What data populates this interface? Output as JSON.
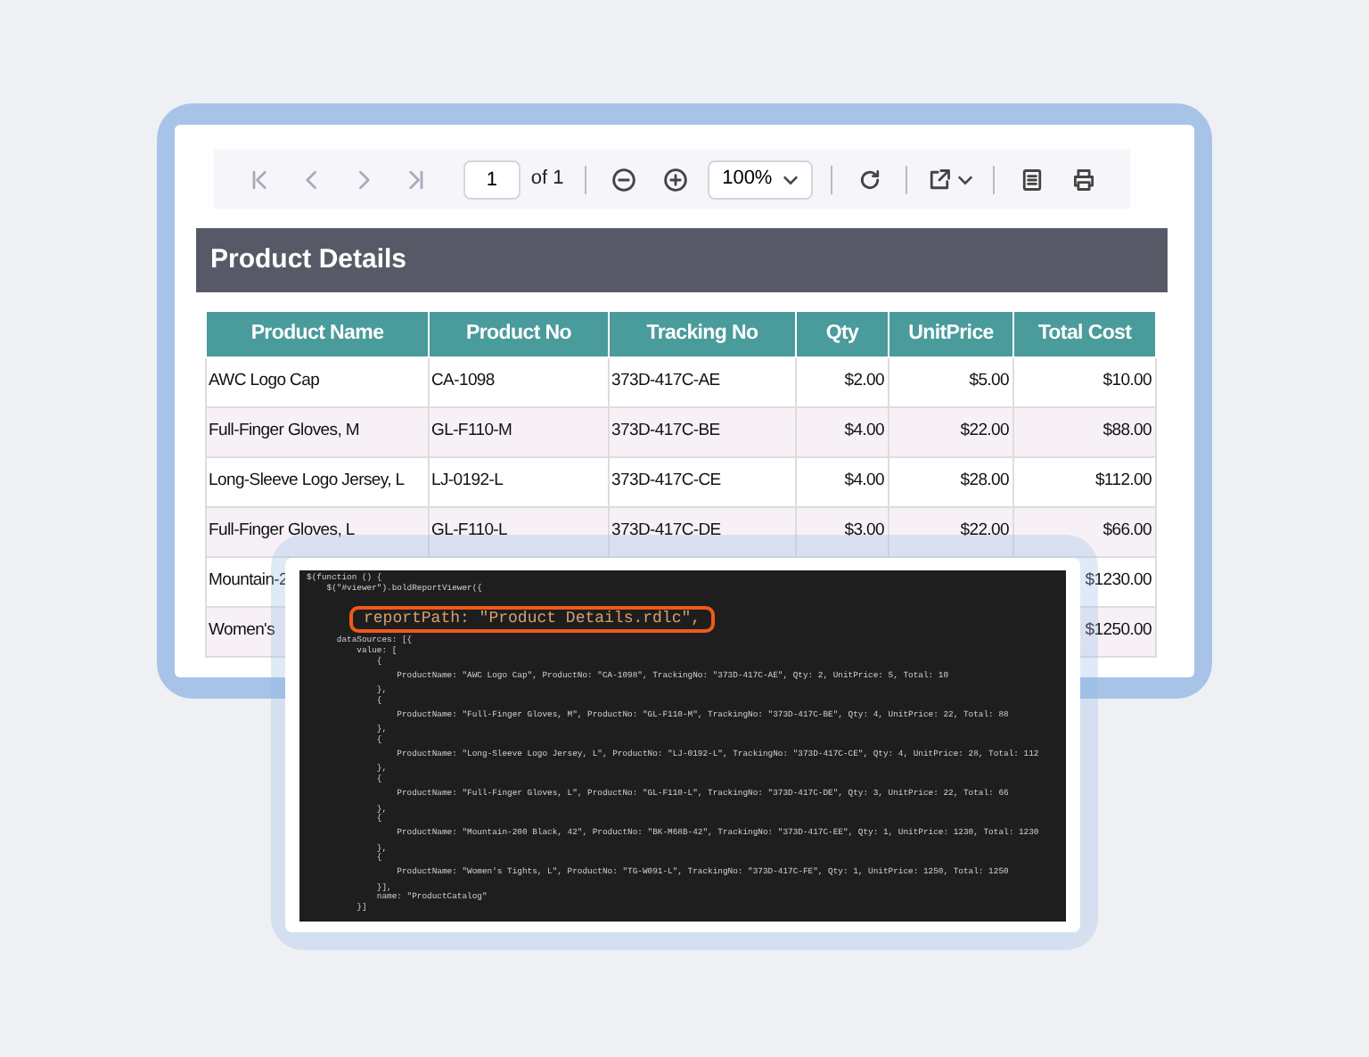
{
  "viewer": {
    "toolbar": {
      "page": "1",
      "page_count": "of 1",
      "zoom": "100%"
    },
    "report_title": "Product Details",
    "table": {
      "columns": [
        "Product Name",
        "Product No",
        "Tracking No",
        "Qty",
        "UnitPrice",
        "Total Cost"
      ],
      "rows": [
        {
          "product_name": "AWC Logo Cap",
          "product_no": "CA-1098",
          "tracking_no": "373D-417C-AE",
          "qty": "$2.00",
          "unit_price": "$5.00",
          "total_cost": "$10.00"
        },
        {
          "product_name": "Full-Finger Gloves, M",
          "product_no": "GL-F110-M",
          "tracking_no": "373D-417C-BE",
          "qty": "$4.00",
          "unit_price": "$22.00",
          "total_cost": "$88.00"
        },
        {
          "product_name": "Long-Sleeve Logo Jersey, L",
          "product_no": "LJ-0192-L",
          "tracking_no": "373D-417C-CE",
          "qty": "$4.00",
          "unit_price": "$28.00",
          "total_cost": "$112.00"
        },
        {
          "product_name": "Full-Finger Gloves, L",
          "product_no": "GL-F110-L",
          "tracking_no": "373D-417C-DE",
          "qty": "$3.00",
          "unit_price": "$22.00",
          "total_cost": "$66.00"
        },
        {
          "product_name": "Mountain-2",
          "total_cost": "$1230.00"
        },
        {
          "product_name": "Women's",
          "total_cost": "$1250.00"
        }
      ]
    }
  },
  "code_editor": {
    "lines": [
      {
        "kind": "code",
        "text": "$(function () {"
      },
      {
        "kind": "code",
        "text": "    $(\"#viewer\").boldReportViewer({"
      },
      {
        "kind": "highlight",
        "text": "reportPath: \"Product Details.rdlc\","
      },
      {
        "kind": "code",
        "text": "      dataSources: [{"
      },
      {
        "kind": "code",
        "text": "          value: ["
      },
      {
        "kind": "code",
        "text": "              {"
      },
      {
        "kind": "record",
        "text": "                  ProductName: \"AWC Logo Cap\", ProductNo: \"CA-1098\", TrackingNo: \"373D-417C-AE\", Qty: 2, UnitPrice: 5, Total: 10"
      },
      {
        "kind": "code",
        "text": "              },"
      },
      {
        "kind": "code",
        "text": "              {"
      },
      {
        "kind": "record",
        "text": "                  ProductName: \"Full-Finger Gloves, M\", ProductNo: \"GL-F110-M\", TrackingNo: \"373D-417C-BE\", Qty: 4, UnitPrice: 22, Total: 88"
      },
      {
        "kind": "code",
        "text": "              },"
      },
      {
        "kind": "code",
        "text": "              {"
      },
      {
        "kind": "record",
        "text": "                  ProductName: \"Long-Sleeve Logo Jersey, L\", ProductNo: \"LJ-0192-L\", TrackingNo: \"373D-417C-CE\", Qty: 4, UnitPrice: 28, Total: 112"
      },
      {
        "kind": "code",
        "text": "              },"
      },
      {
        "kind": "code",
        "text": "              {"
      },
      {
        "kind": "record",
        "text": "                  ProductName: \"Full-Finger Gloves, L\", ProductNo: \"GL-F110-L\", TrackingNo: \"373D-417C-DE\", Qty: 3, UnitPrice: 22, Total: 66"
      },
      {
        "kind": "code",
        "text": "              },"
      },
      {
        "kind": "code",
        "text": "              {"
      },
      {
        "kind": "record",
        "text": "                  ProductName: \"Mountain-200 Black, 42\", ProductNo: \"BK-M68B-42\", TrackingNo: \"373D-417C-EE\", Qty: 1, UnitPrice: 1230, Total: 1230"
      },
      {
        "kind": "code",
        "text": "              },"
      },
      {
        "kind": "code",
        "text": "              {"
      },
      {
        "kind": "record",
        "text": "                  ProductName: \"Women's Tights, L\", ProductNo: \"TG-W091-L\", TrackingNo: \"373D-417C-FE\", Qty: 1, UnitPrice: 1250, Total: 1250"
      },
      {
        "kind": "code",
        "text": "              }],"
      },
      {
        "kind": "code",
        "text": "              name: \"ProductCatalog\""
      },
      {
        "kind": "code",
        "text": "          }]"
      }
    ]
  }
}
